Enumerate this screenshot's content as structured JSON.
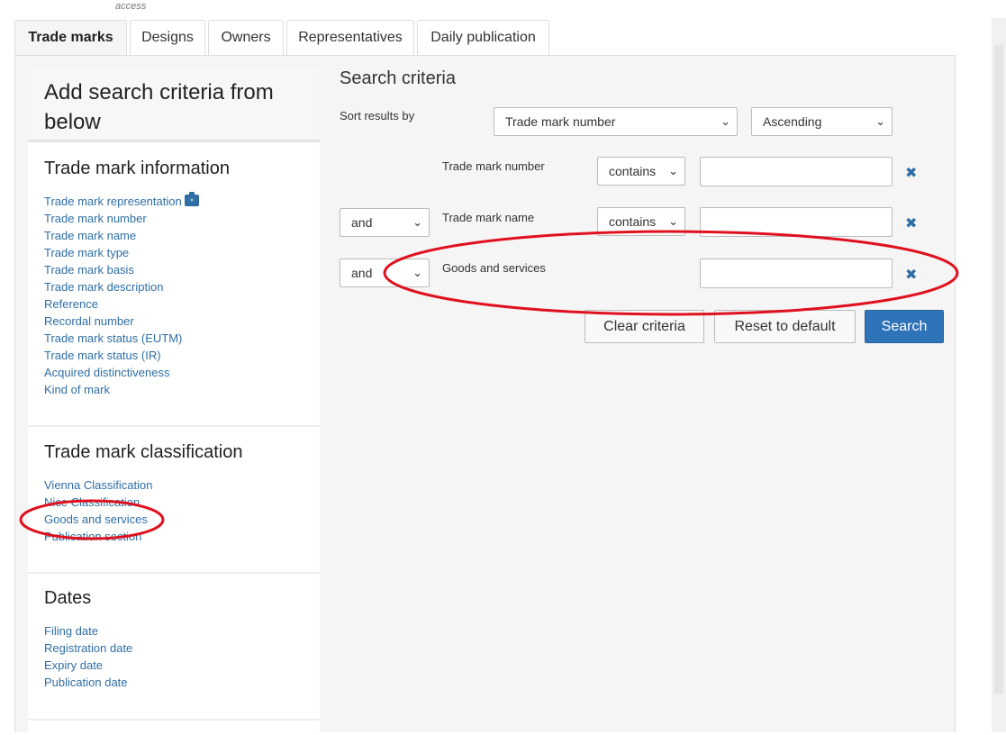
{
  "top_note": "access",
  "tabs": [
    {
      "label": "Trade marks",
      "active": true
    },
    {
      "label": "Designs"
    },
    {
      "label": "Owners"
    },
    {
      "label": "Representatives"
    },
    {
      "label": "Daily publication"
    }
  ],
  "sidebar": {
    "header": "Add search criteria from below",
    "sections": [
      {
        "title": "Trade mark information",
        "items": [
          "Trade mark representation",
          "Trade mark number",
          "Trade mark name",
          "Trade mark type",
          "Trade mark basis",
          "Trade mark description",
          "Reference",
          "Recordal number",
          "Trade mark status (EUTM)",
          "Trade mark status (IR)",
          "Acquired distinctiveness",
          "Kind of mark"
        ]
      },
      {
        "title": "Trade mark classification",
        "items": [
          "Vienna Classification",
          "Nice Classification",
          "Goods and services",
          "Publication section"
        ]
      },
      {
        "title": "Dates",
        "items": [
          "Filing date",
          "Registration date",
          "Expiry date",
          "Publication date"
        ]
      }
    ]
  },
  "criteria": {
    "title": "Search criteria",
    "sort_label": "Sort results by",
    "sort_field": "Trade mark number",
    "sort_order": "Ascending",
    "rows": [
      {
        "connector": "",
        "field": "Trade mark number",
        "operator": "contains",
        "value": ""
      },
      {
        "connector": "and",
        "field": "Trade mark name",
        "operator": "contains",
        "value": ""
      },
      {
        "connector": "and",
        "field": "Goods and services",
        "operator": "",
        "value": ""
      }
    ]
  },
  "buttons": {
    "clear": "Clear criteria",
    "reset": "Reset to default",
    "search": "Search"
  },
  "colors": {
    "link": "#2f6ea5",
    "primary_button": "#2f73b8",
    "annotation": "#e0101e"
  },
  "icons": {
    "camera": "camera-icon",
    "remove": "remove-icon",
    "dropdown": "chevron-down-icon"
  }
}
